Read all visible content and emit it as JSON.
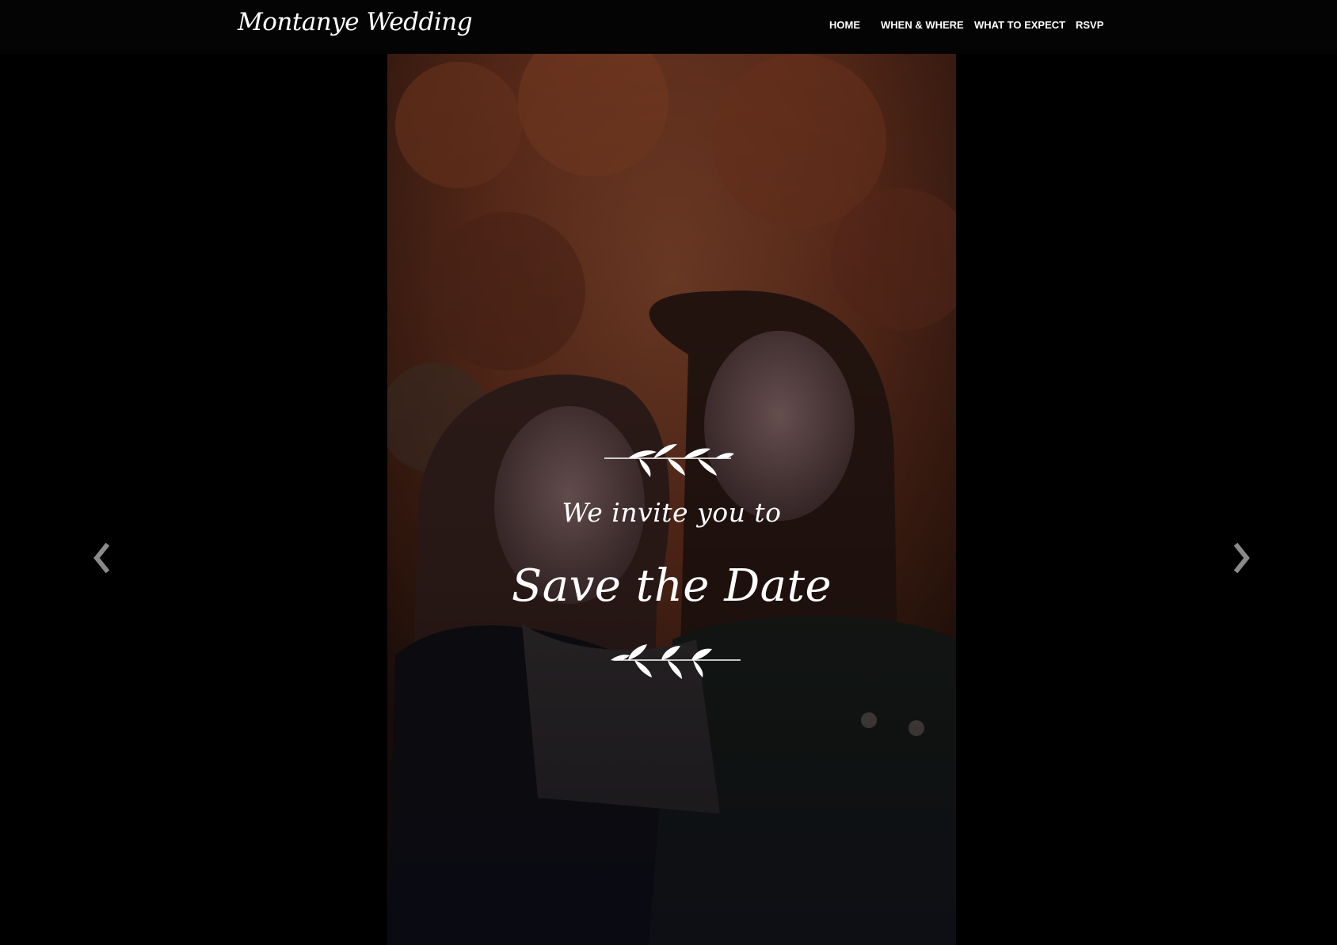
{
  "brand": {
    "title": "Montanye Wedding"
  },
  "nav": {
    "items": [
      {
        "label": "HOME"
      },
      {
        "label": "WHEN & WHERE"
      },
      {
        "label": "WHAT TO EXPECT"
      },
      {
        "label": "RSVP"
      }
    ]
  },
  "hero": {
    "invite_text": "We invite you to",
    "headline": "Save the Date"
  },
  "carousel": {
    "prev_icon": "chevron-left-icon",
    "next_icon": "chevron-right-icon"
  },
  "colors": {
    "background": "#000000",
    "text": "#ffffff",
    "arrow": "#8a8a8a"
  }
}
